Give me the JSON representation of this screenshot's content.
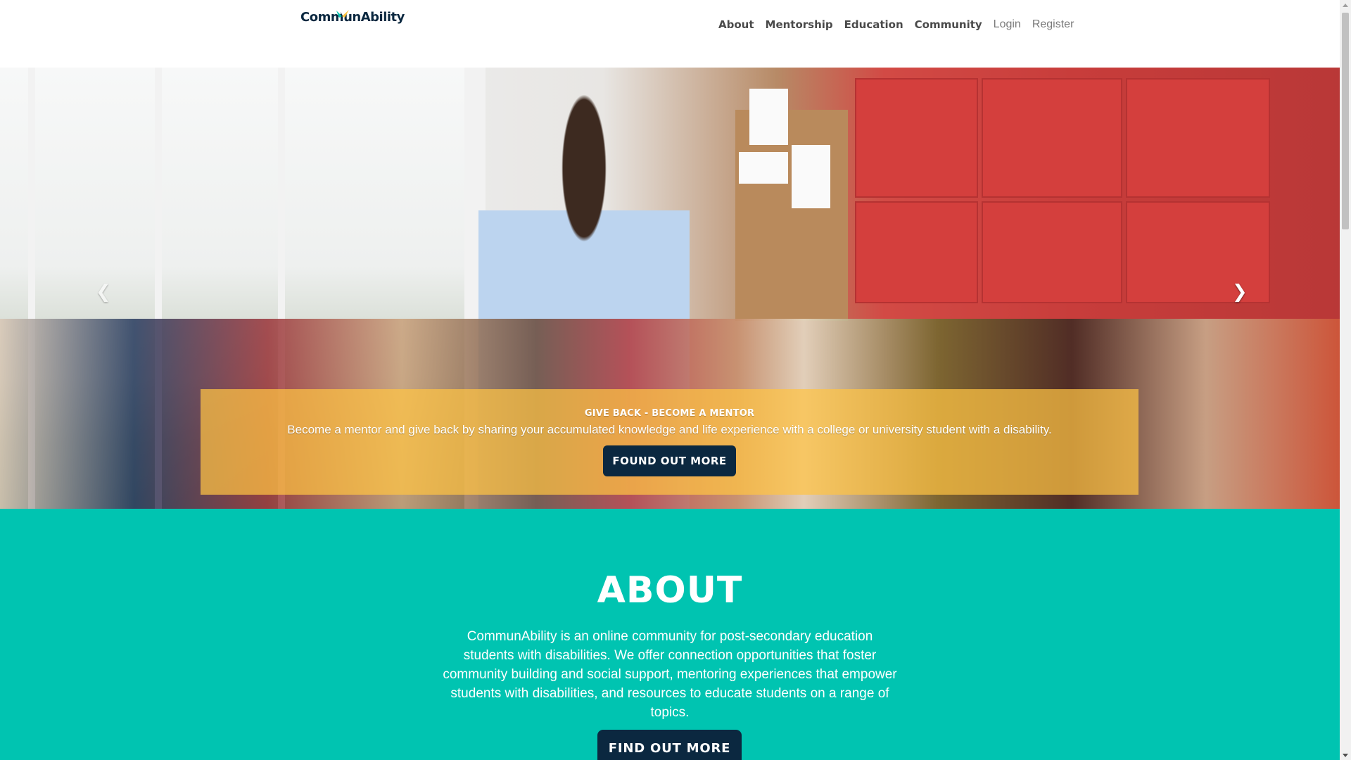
{
  "header": {
    "logo_text": "CommunAbility",
    "nav": [
      {
        "label": "About"
      },
      {
        "label": "Mentorship"
      },
      {
        "label": "Education"
      },
      {
        "label": "Community"
      },
      {
        "label": "Login"
      },
      {
        "label": "Register"
      }
    ]
  },
  "hero": {
    "prev_icon": "chevron-left-icon",
    "next_icon": "chevron-right-icon",
    "caption": {
      "title": "Give Back - Become a Mentor",
      "text": "Become a mentor and give back by sharing your accumulated knowledge and life experience with a college or university student with a disability.",
      "button_label": "Found out more"
    }
  },
  "about": {
    "title": "ABOUT",
    "text": "CommunAbility is an online community for post-secondary education students with disabilities. We offer connection opportunities that foster community building and social support, mentoring experiences that empower students with disabilities, and resources to educate students on a range of topics.",
    "button_label": "Find out more"
  },
  "colors": {
    "navy": "#0b2840",
    "teal": "#00c4b1",
    "caption_yellow": "#ffc444"
  }
}
